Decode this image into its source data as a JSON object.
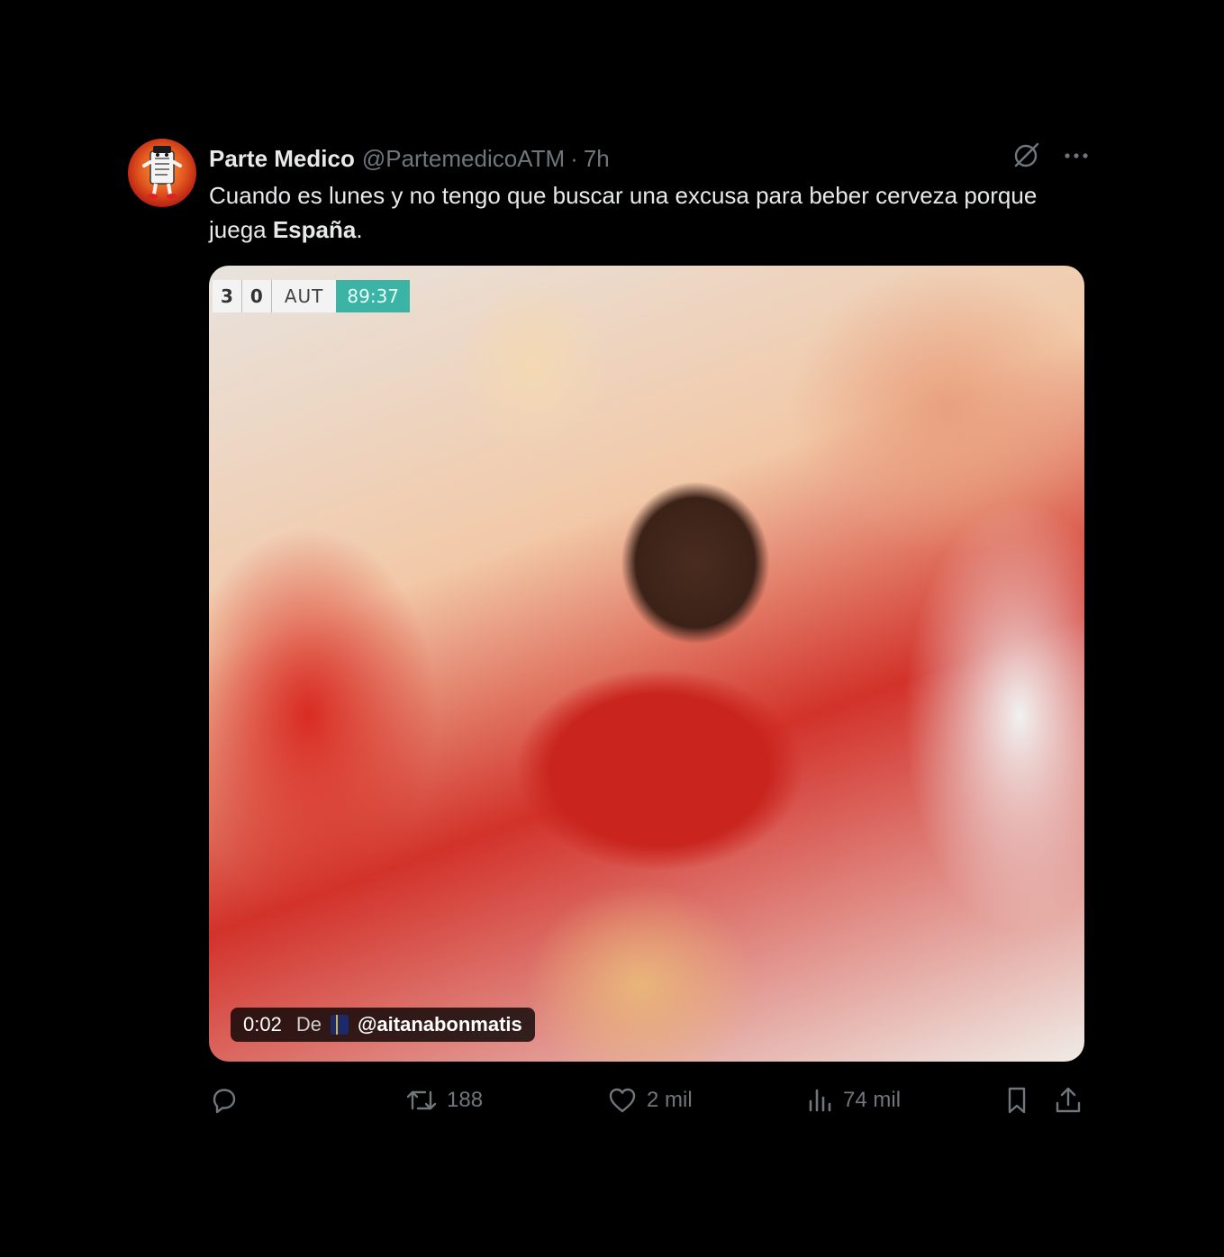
{
  "tweet": {
    "author_name": "Parte Medico",
    "handle": "@PartemedicoATM",
    "separator": "·",
    "time": "7h",
    "text_before_bold": "Cuando es lunes y no tengo que buscar una excusa para beber cerveza porque juega ",
    "text_bold": "España",
    "text_after_bold": "."
  },
  "media": {
    "score_home": "3",
    "score_away": "0",
    "team": "AUT",
    "clock": "89:37",
    "video_time": "0:02",
    "from_label": "De",
    "from_user": "@aitanabonmatis"
  },
  "actions": {
    "reply_icon": "reply-icon",
    "retweet_count": "188",
    "like_count": "2 mil",
    "views_count": "74 mil",
    "bookmark_icon": "bookmark-icon",
    "share_icon": "share-icon"
  },
  "colors": {
    "background": "#000000",
    "text_primary": "#e7e9ea",
    "text_secondary": "#71767b",
    "scoreboard_clock": "#3bb3a5"
  }
}
